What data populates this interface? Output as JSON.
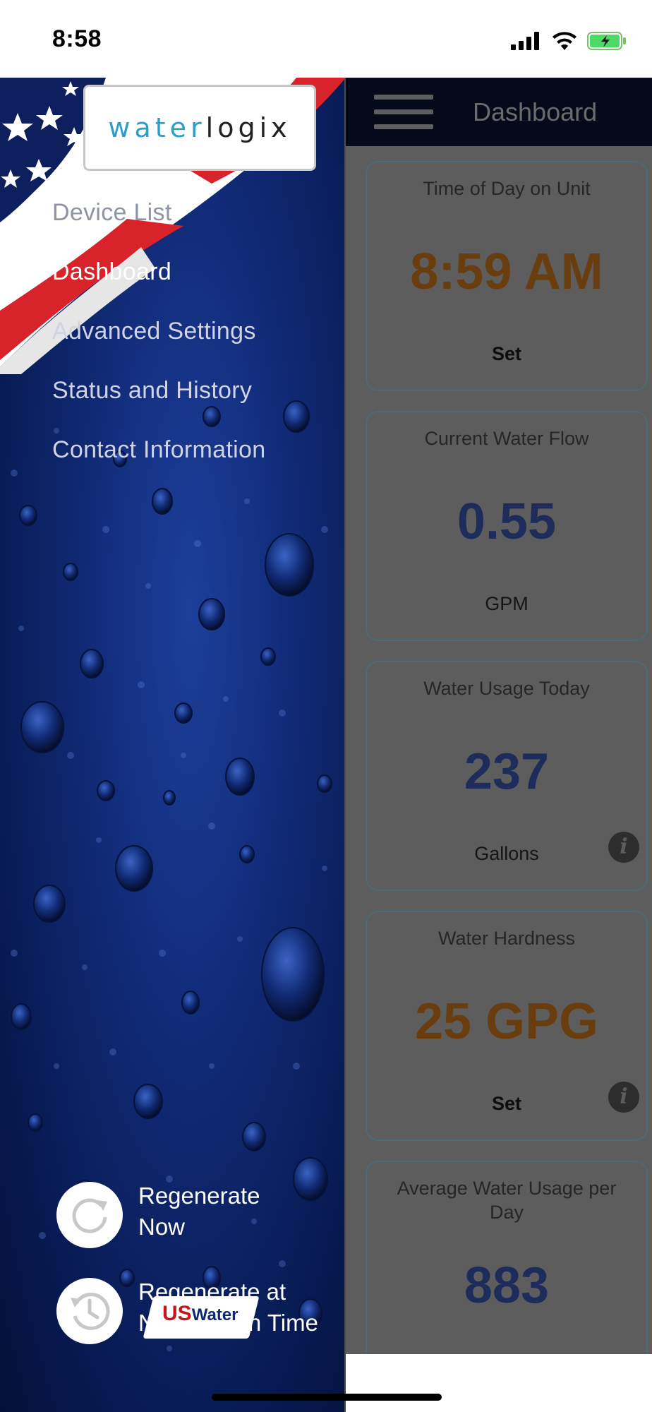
{
  "status_bar": {
    "time": "8:58"
  },
  "dashboard": {
    "title": "Dashboard",
    "cards": [
      {
        "label": "Time of Day on Unit",
        "value": "8:59 AM",
        "sub": "Set",
        "accent": "#6a3d0e",
        "info": false
      },
      {
        "label": "Current Water Flow",
        "value": "0.55",
        "sub": "GPM",
        "accent": "#1e2c5c",
        "info": false
      },
      {
        "label": "Water Usage Today",
        "value": "237",
        "sub": "Gallons",
        "accent": "#1e2c5c",
        "info": true
      },
      {
        "label": "Water Hardness",
        "value": "25 GPG",
        "sub": "Set",
        "accent": "#6a3d0e",
        "info": true
      },
      {
        "label": "Average Water Usage per Day",
        "value": "883",
        "sub": "",
        "accent": "#1e2c5c",
        "info": false
      }
    ]
  },
  "menu": {
    "logo": {
      "water": "water",
      "rest": "logix"
    },
    "items": [
      {
        "label": "Device List",
        "state": "dim"
      },
      {
        "label": "Dashboard",
        "state": "active"
      },
      {
        "label": "Advanced Settings",
        "state": "normal"
      },
      {
        "label": "Status and History",
        "state": "normal"
      },
      {
        "label": "Contact Information",
        "state": "normal"
      }
    ],
    "actions": {
      "regenerate_now": {
        "line1": "Regenerate",
        "line2": "Now",
        "icon": "refresh-icon"
      },
      "regenerate_next": {
        "line1": "Regenerate at",
        "line2": "Next Regen Time",
        "icon": "clock-history-icon"
      }
    },
    "footer_logo": {
      "us": "US",
      "water": "Water"
    }
  }
}
